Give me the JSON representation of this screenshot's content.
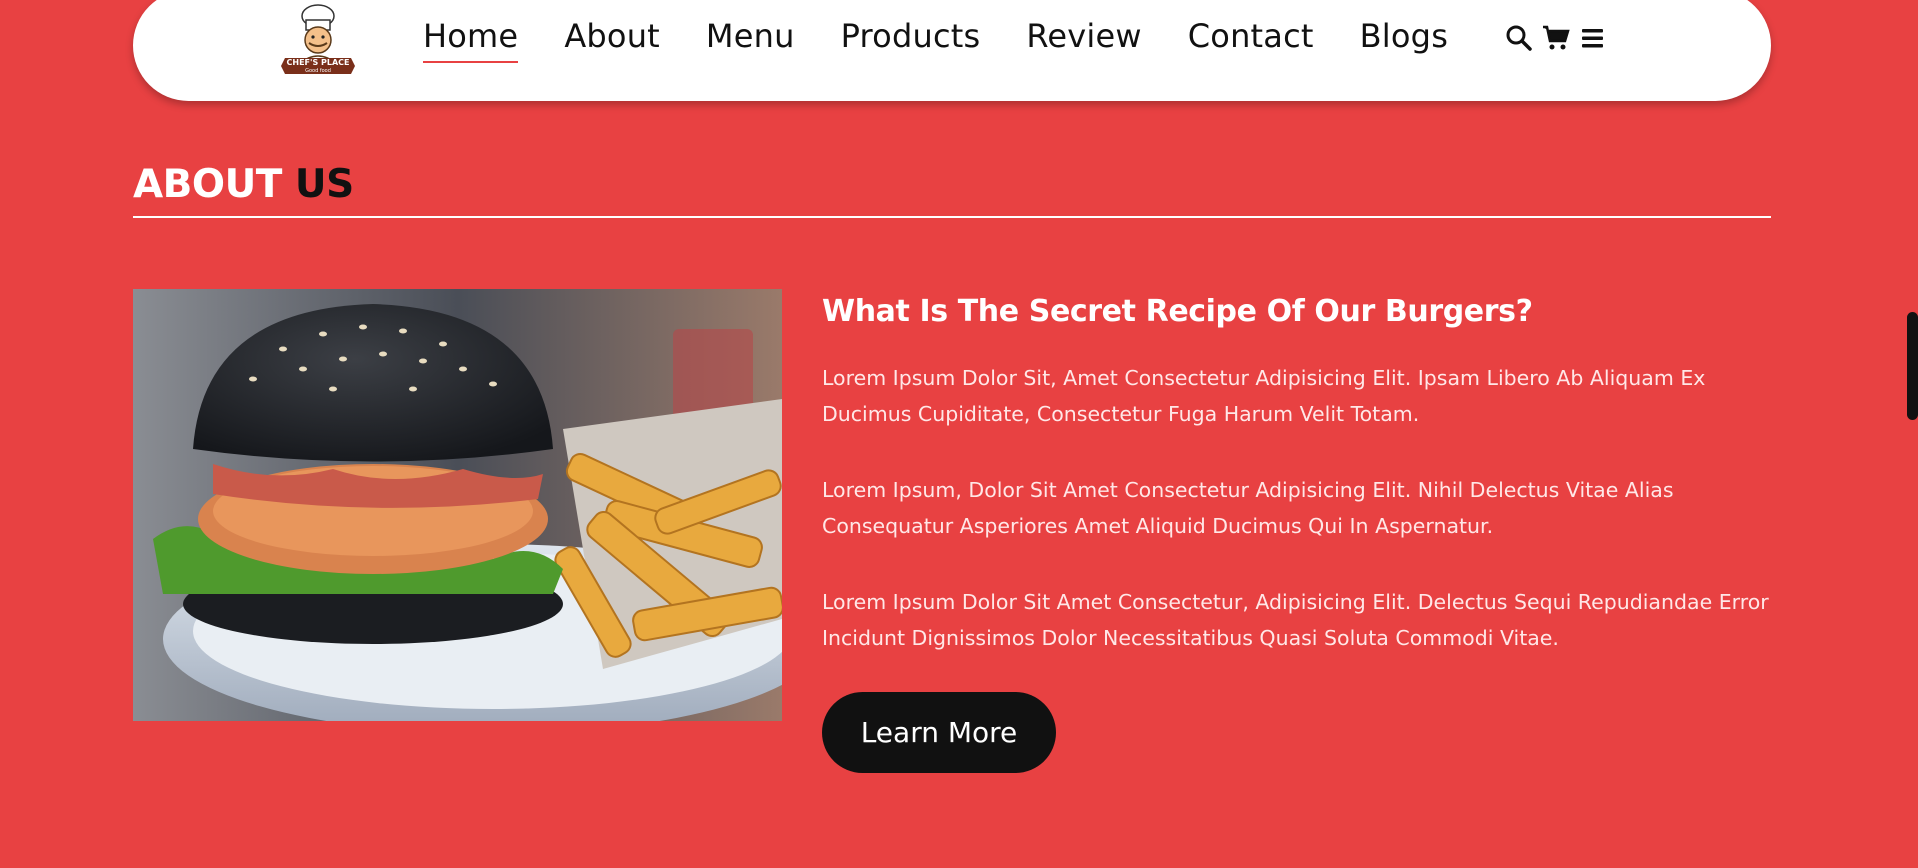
{
  "brand": {
    "logo_text": "CHEF'S PLACE",
    "logo_subtext": "Good food"
  },
  "nav": {
    "links": [
      {
        "label": "Home",
        "active": true
      },
      {
        "label": "About",
        "active": false
      },
      {
        "label": "Menu",
        "active": false
      },
      {
        "label": "Products",
        "active": false
      },
      {
        "label": "Review",
        "active": false
      },
      {
        "label": "Contact",
        "active": false
      },
      {
        "label": "Blogs",
        "active": false
      }
    ],
    "icons": [
      "search-icon",
      "cart-icon",
      "menu-icon"
    ]
  },
  "about": {
    "title_part1": "ABOUT",
    "title_part2": "US",
    "image_alt": "burger-with-fries",
    "heading": "What Is The Secret Recipe Of Our Burgers?",
    "paragraphs": [
      "Lorem Ipsum Dolor Sit, Amet Consectetur Adipisicing Elit. Ipsam Libero Ab Aliquam Ex Ducimus Cupiditate, Consectetur Fuga Harum Velit Totam.",
      "Lorem Ipsum, Dolor Sit Amet Consectetur Adipisicing Elit. Nihil Delectus Vitae Alias Consequatur Asperiores Amet Aliquid Ducimus Qui In Aspernatur.",
      "Lorem Ipsum Dolor Sit Amet Consectetur, Adipisicing Elit. Delectus Sequi Repudiandae Error Incidunt Dignissimos Dolor Necessitatibus Quasi Soluta Commodi Vitae."
    ],
    "button_label": "Learn More"
  },
  "colors": {
    "background": "#e84142",
    "accent_dark": "#111111",
    "nav_bg": "#ffffff"
  }
}
